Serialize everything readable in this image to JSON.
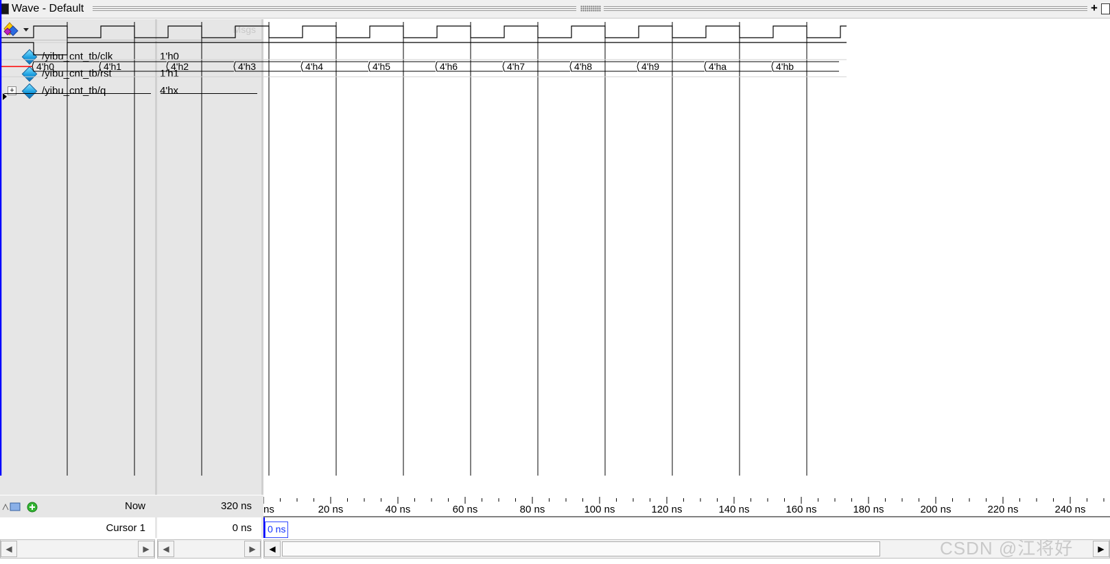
{
  "window": {
    "title": "Wave - Default",
    "msgs_header": "Msgs"
  },
  "signals": [
    {
      "name": "/yibu_cnt_tb/clk",
      "value": "1'h0",
      "expandable": false
    },
    {
      "name": "/yibu_cnt_tb/rst",
      "value": "1'h1",
      "expandable": false
    },
    {
      "name": "/yibu_cnt_tb/q",
      "value": "4'hx",
      "expandable": true
    }
  ],
  "q_values": [
    "4'h0",
    "4'h1",
    "4'h2",
    "4'h3",
    "4'h4",
    "4'h5",
    "4'h6",
    "4'h7",
    "4'h8",
    "4'h9",
    "4'ha",
    "4'hb"
  ],
  "timeline": {
    "labels": [
      "ns",
      "20 ns",
      "40 ns",
      "60 ns",
      "80 ns",
      "100 ns",
      "120 ns",
      "140 ns",
      "160 ns",
      "180 ns",
      "200 ns",
      "220 ns",
      "240 ns"
    ]
  },
  "footer": {
    "now_label": "Now",
    "now_value": "320 ns",
    "cursor_label": "Cursor 1",
    "cursor_value": "0 ns",
    "cursor_marker": "0 ns"
  },
  "watermark": "CSDN @江将好",
  "colors": {
    "cursor": "#0000ff",
    "wave": "#000000",
    "unknown": "#ff0000",
    "pane_bg": "#e6e6e6"
  },
  "icons": [
    "wave-window-icon",
    "toolbar-wave-icon",
    "signal-icon",
    "expand-icon",
    "lock-icon",
    "scroll-left-icon",
    "scroll-right-icon"
  ]
}
